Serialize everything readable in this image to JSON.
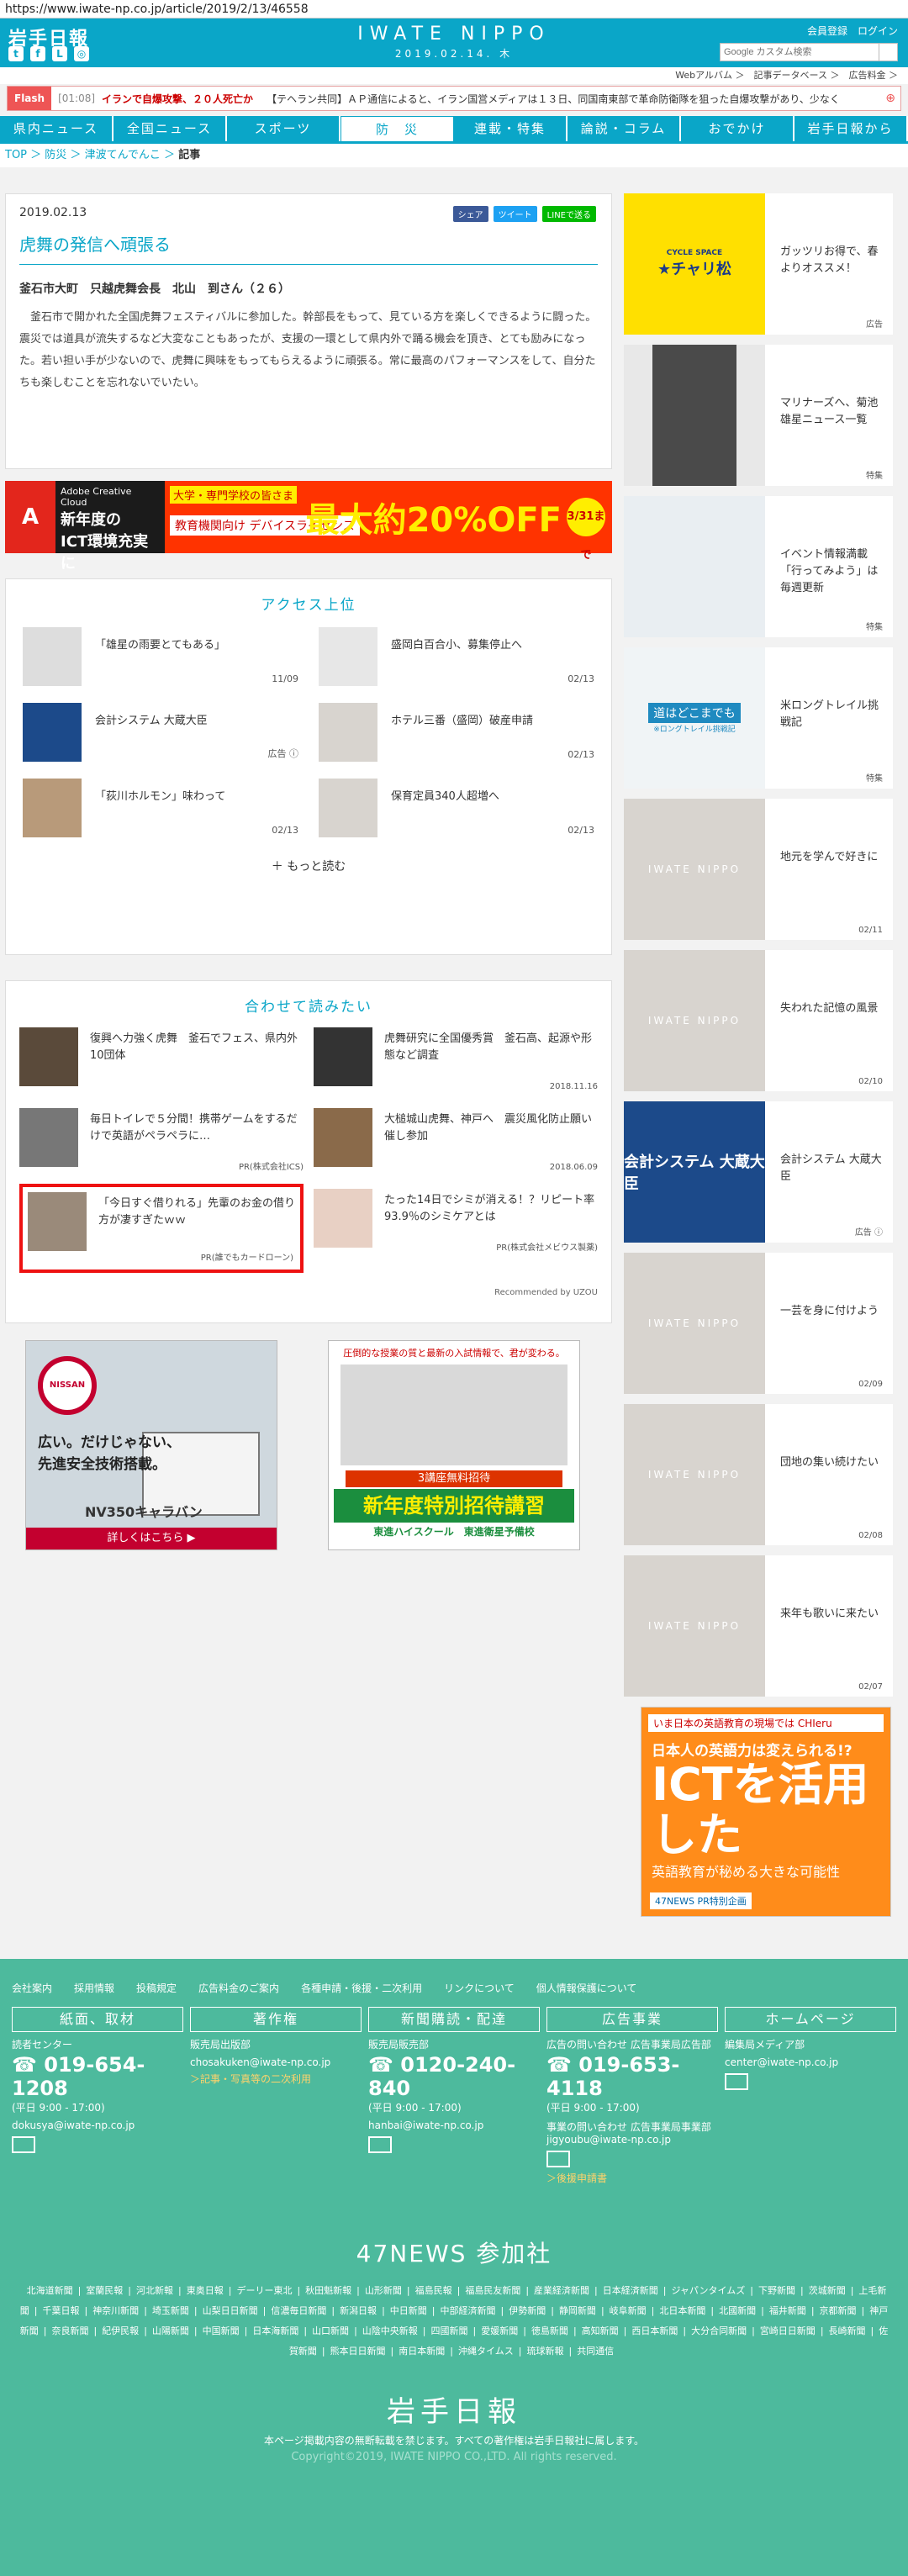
{
  "url": "https://www.iwate-np.co.jp/article/2019/2/13/46558",
  "header": {
    "logo": "岩手日報",
    "brand": "IWATE NIPPO",
    "date": "2019.02.14. 木",
    "links": "会員登録　ログイン",
    "search_placeholder": "Google カスタム検索",
    "sublinks": "Webアルバム ＞　記事データベース ＞　広告料金 ＞"
  },
  "flash": {
    "tag": "Flash",
    "time": "[01:08]",
    "headline": "イランで自爆攻撃、２０人死亡か",
    "body": "【テヘラン共同】ＡＰ通信によると、イラン国営メディアは１３日、同国南東部で革命防衛隊を狙った自爆攻撃があり、少なく"
  },
  "nav": [
    "県内ニュース",
    "全国ニュース",
    "スポーツ",
    "防　災",
    "連載・特集",
    "論説・コラム",
    "おでかけ",
    "岩手日報から"
  ],
  "breadcrumb": [
    "TOP",
    "防災",
    "津波てんでんこ",
    "記事"
  ],
  "article": {
    "date": "2019.02.13",
    "share": [
      "シェア",
      "ツイート",
      "LINEで送る"
    ],
    "title": "虎舞の発信へ頑張る",
    "who": "釜石市大町　只越虎舞会長　北山　到さん（２６）",
    "body": "釜石市で開かれた全国虎舞フェスティバルに参加した。幹部長をもって、見ている方を楽しくできるように闘った。震災では道具が流失するなど大変なこともあったが、支援の一環として県内外で踊る機会を頂き、とても励みになった。若い担い手が少ないので、虎舞に興味をもってもらえるように頑張る。常に最高のパフォーマンスをして、自分たちも楽しむことを忘れないでいたい。"
  },
  "ad_adobe": {
    "brand": "Adobe Creative Cloud",
    "l1": "新年度の",
    "l2": "ICT環境充実に",
    "l3": "大学・専門学校の皆さま",
    "l4": "教育機関向け デバイスライセンス",
    "big": "最大約20%OFF",
    "badge": "3/31まで"
  },
  "ranking": {
    "title": "アクセス上位",
    "items": [
      {
        "title": "「雄星の雨要とてもある」",
        "date": "11/09"
      },
      {
        "title": "盛岡白百合小、募集停止へ",
        "date": "02/13"
      },
      {
        "title": "会計システム 大蔵大臣",
        "date": "広告 ⓘ"
      },
      {
        "title": "ホテル三番（盛岡）破産申請",
        "date": "02/13"
      },
      {
        "title": "「荻川ホルモン」味わって",
        "date": "02/13"
      },
      {
        "title": "保育定員340人超増へ",
        "date": "02/13"
      }
    ],
    "more": "もっと読む"
  },
  "related": {
    "title": "合わせて読みたい",
    "items": [
      {
        "title": "復興へ力強く虎舞　釜石でフェス、県内外10団体",
        "date": ""
      },
      {
        "title": "虎舞研究に全国優秀賞　釜石高、起源や形態など調査",
        "date": "2018.11.16"
      },
      {
        "title": "毎日トイレで５分間！携帯ゲームをするだけで英語がペラペラに…",
        "date": "PR(株式会社ICS)"
      },
      {
        "title": "大槌城山虎舞、神戸へ　震災風化防止願い催し参加",
        "date": "2018.06.09"
      },
      {
        "title": "「今日すぐ借りれる」先輩のお金の借り方が凄すぎたｗｗ",
        "date": "PR(誰でもカードローン)"
      },
      {
        "title": "たった14日でシミが消える！？リピート率93.9％のシミケアとは",
        "date": "PR(株式会社メビウス製薬)"
      }
    ],
    "recby": "Recommended by UZOU"
  },
  "ad_nissan": {
    "logo": "NISSAN",
    "l1": "広い。だけじゃない、",
    "l2": "先進安全技術搭載。",
    "model": "NV350キャラバン",
    "btn": "詳しくはこちら ▶"
  },
  "ad_juku": {
    "h": "圧倒的な授業の質と最新の入試情報で、君が変わる。",
    "b1": "3講座無料招待",
    "b2": "新年度特別招待講習",
    "b3": "東進ハイスクール　東進衛星予備校"
  },
  "sidebar": [
    {
      "title": "ガッツリお得で、春よりオススメ！",
      "date": "広告",
      "kind": "ad"
    },
    {
      "title": "マリナーズへ、菊池雄星ニュース一覧",
      "date": "特集",
      "kind": "photo"
    },
    {
      "title": "イベント情報満載「行ってみよう」は毎週更新",
      "date": "特集",
      "kind": "snow"
    },
    {
      "title": "米ロングトレイル挑戦記",
      "date": "特集",
      "kind": "trail"
    },
    {
      "title": "地元を学んで好きに",
      "date": "02/11",
      "kind": "iwate"
    },
    {
      "title": "失われた記憶の風景",
      "date": "02/10",
      "kind": "iwate"
    },
    {
      "title": "会計システム 大蔵大臣",
      "date": "広告 ⓘ",
      "kind": "okura"
    },
    {
      "title": "一芸を身に付けよう",
      "date": "02/09",
      "kind": "iwate"
    },
    {
      "title": "団地の集い続けたい",
      "date": "02/08",
      "kind": "iwate"
    },
    {
      "title": "来年も歌いに来たい",
      "date": "02/07",
      "kind": "iwate"
    }
  ],
  "sidebar_iwate": "IWATE NIPPO",
  "sidebar_ad_text": {
    "cycle": "CYCLE SPACE",
    "chari": "★チャリ松",
    "trail": "道はどこまでも",
    "trail_sub": "※ロングトレイル挑戦記",
    "okura": "会計システム 大蔵大臣"
  },
  "ad_eng": {
    "t1": "いま日本の英語教育の現場では CHIeru",
    "t2": "日本人の英語力は変えられる!?",
    "t3": "ICTを活用した",
    "t4": "英語教育が秘める大きな可能性",
    "t5": "47NEWS PR特別企画"
  },
  "footer": {
    "nav": [
      "会社案内",
      "採用情報",
      "投稿規定",
      "広告料金のご案内",
      "各種申請・後援・二次利用",
      "リンクについて",
      "個人情報保護について"
    ],
    "cols": [
      {
        "hd": "紙面、取材",
        "l": "読者センター",
        "tel": "019-654-1208",
        "hr": "(平日 9:00 - 17:00)",
        "mail": "dokusya@iwate-np.co.jp",
        "lk": ""
      },
      {
        "hd": "著作権",
        "l": "販売局出版部",
        "tel": "",
        "hr": "",
        "mail": "chosakuken@iwate-np.co.jp",
        "lk": "＞記事・写真等の二次利用"
      },
      {
        "hd": "新聞購読・配達",
        "l": "販売局販売部",
        "tel": "0120-240-840",
        "hr": "(平日 9:00 - 17:00)",
        "mail": "hanbai@iwate-np.co.jp",
        "lk": ""
      },
      {
        "hd": "広告事業",
        "l": "広告の問い合わせ 広告事業局広告部",
        "tel": "019-653-4118",
        "hr": "(平日 9:00 - 17:00)",
        "mail": "事業の問い合わせ 広告事業局事業部 jigyoubu@iwate-np.co.jp",
        "lk": "＞後援申請書"
      },
      {
        "hd": "ホームページ",
        "l": "編集局メディア部",
        "tel": "",
        "hr": "",
        "mail": "center@iwate-np.co.jp",
        "lk": ""
      }
    ],
    "news47": "47NEWS 参加社",
    "papers": [
      "北海道新聞",
      "室蘭民報",
      "河北新報",
      "東奥日報",
      "デーリー東北",
      "秋田魁新報",
      "山形新聞",
      "福島民報",
      "福島民友新聞",
      "産業経済新聞",
      "日本経済新聞",
      "ジャパンタイムズ",
      "下野新聞",
      "茨城新聞",
      "上毛新聞",
      "千葉日報",
      "神奈川新聞",
      "埼玉新聞",
      "山梨日日新聞",
      "信濃毎日新聞",
      "新潟日報",
      "中日新聞",
      "中部経済新聞",
      "伊勢新聞",
      "静岡新聞",
      "岐阜新聞",
      "北日本新聞",
      "北國新聞",
      "福井新聞",
      "京都新聞",
      "神戸新聞",
      "奈良新聞",
      "紀伊民報",
      "山陽新聞",
      "中国新聞",
      "日本海新聞",
      "山口新聞",
      "山陰中央新報",
      "四國新聞",
      "愛媛新聞",
      "徳島新聞",
      "高知新聞",
      "西日本新聞",
      "大分合同新聞",
      "宮崎日日新聞",
      "長崎新聞",
      "佐賀新聞",
      "熊本日日新聞",
      "南日本新聞",
      "沖縄タイムス",
      "琉球新報",
      "共同通信"
    ],
    "logo": "岩手日報",
    "notice": "本ページ掲載内容の無断転載を禁じます。すべての著作権は岩手日報社に属します。",
    "copy": "Copyright©2019, IWATE NIPPO CO.,LTD. All rights reserved."
  }
}
